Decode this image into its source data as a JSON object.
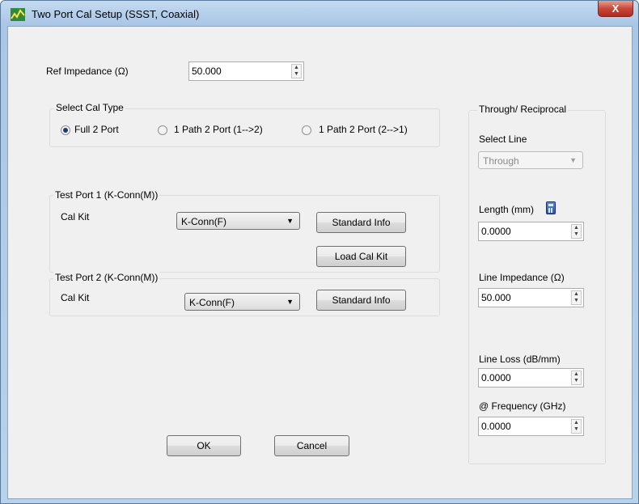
{
  "window": {
    "title": "Two Port Cal Setup (SSST, Coaxial)",
    "close_label": "X"
  },
  "ref_impedance": {
    "label": "Ref Impedance (Ω)",
    "value": "50.000"
  },
  "cal_type": {
    "title": "Select Cal Type",
    "options": [
      {
        "label": "Full 2 Port",
        "selected": true
      },
      {
        "label": "1 Path 2 Port (1-->2)",
        "selected": false
      },
      {
        "label": "1 Path 2 Port (2-->1)",
        "selected": false
      }
    ]
  },
  "test_port_1": {
    "title": "Test Port 1 (K-Conn(M))",
    "cal_kit_label": "Cal Kit",
    "cal_kit_value": "K-Conn(F)",
    "standard_info_label": "Standard Info",
    "load_cal_kit_label": "Load Cal Kit"
  },
  "test_port_2": {
    "title": "Test Port 2 (K-Conn(M))",
    "cal_kit_label": "Cal Kit",
    "cal_kit_value": "K-Conn(F)",
    "standard_info_label": "Standard Info"
  },
  "through": {
    "title": "Through/ Reciprocal",
    "select_line_label": "Select Line",
    "select_line_value": "Through",
    "length_label": "Length (mm)",
    "length_value": "0.0000",
    "line_impedance_label": "Line Impedance (Ω)",
    "line_impedance_value": "50.000",
    "line_loss_label": "Line Loss (dB/mm)",
    "line_loss_value": "0.0000",
    "frequency_label": "@ Frequency (GHz)",
    "frequency_value": "0.0000"
  },
  "buttons": {
    "ok": "OK",
    "cancel": "Cancel"
  },
  "icons": {
    "title": "vna-app-icon",
    "length": "calculator-icon"
  }
}
